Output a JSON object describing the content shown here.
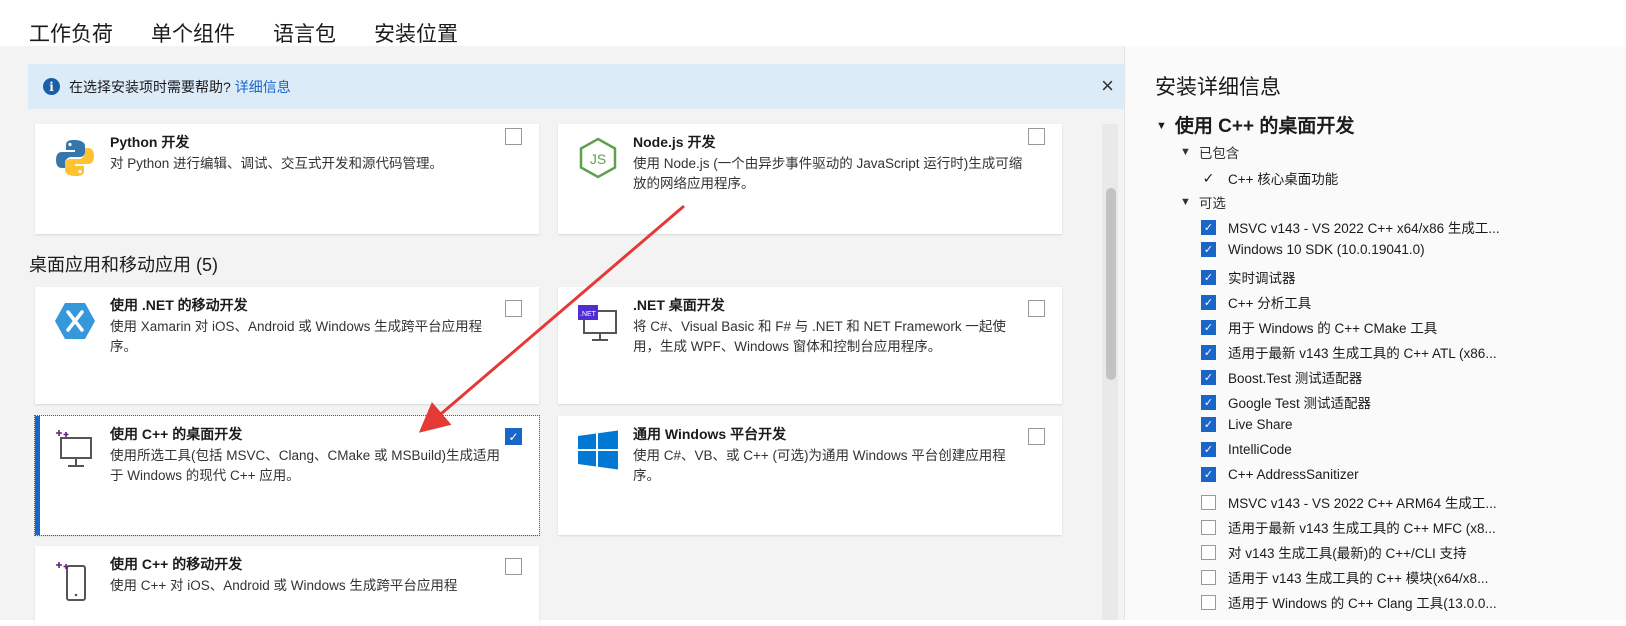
{
  "tabs": [
    "工作负荷",
    "单个组件",
    "语言包",
    "安装位置"
  ],
  "info": {
    "text": "在选择安装项时需要帮助?",
    "link": "详细信息",
    "close": "×"
  },
  "section_title": "桌面应用和移动应用 (5)",
  "cards": [
    {
      "title": "Python 开发",
      "desc": "对 Python 进行编辑、调试、交互式开发和源代码管理。",
      "checked": false
    },
    {
      "title": "Node.js 开发",
      "desc": "使用 Node.js (一个由异步事件驱动的 JavaScript 运行时)生成可缩放的网络应用程序。",
      "checked": false
    },
    {
      "title": "使用 .NET 的移动开发",
      "desc": "使用 Xamarin 对 iOS、Android 或 Windows 生成跨平台应用程序。",
      "checked": false
    },
    {
      "title": ".NET 桌面开发",
      "desc": "将 C#、Visual Basic 和 F# 与 .NET 和 NET Framework 一起使用，生成 WPF、Windows 窗体和控制台应用程序。",
      "checked": false
    },
    {
      "title": "使用 C++ 的桌面开发",
      "desc": "使用所选工具(包括 MSVC、Clang、CMake 或 MSBuild)生成适用于 Windows 的现代 C++ 应用。",
      "checked": true
    },
    {
      "title": "通用 Windows 平台开发",
      "desc": "使用 C#、VB、或 C++ (可选)为通用 Windows 平台创建应用程序。",
      "checked": false
    },
    {
      "title": "使用 C++ 的移动开发",
      "desc": "使用 C++ 对 iOS、Android 或 Windows 生成跨平台应用程",
      "checked": false
    }
  ],
  "node_icon_text": "JS",
  "net_badge": ".NET",
  "detail": {
    "title": "安装详细信息",
    "workload": "使用 C++ 的桌面开发",
    "included_label": "已包含",
    "included": [
      "C++ 核心桌面功能"
    ],
    "optional_label": "可选",
    "optional": [
      {
        "label": "MSVC v143 - VS 2022 C++ x64/x86 生成工...",
        "checked": true
      },
      {
        "label": "Windows 10 SDK (10.0.19041.0)",
        "checked": true
      },
      {
        "label": "实时调试器",
        "checked": true
      },
      {
        "label": "C++ 分析工具",
        "checked": true
      },
      {
        "label": "用于 Windows 的 C++ CMake 工具",
        "checked": true
      },
      {
        "label": "适用于最新 v143 生成工具的 C++ ATL (x86...",
        "checked": true
      },
      {
        "label": "Boost.Test 测试适配器",
        "checked": true
      },
      {
        "label": "Google Test 测试适配器",
        "checked": true
      },
      {
        "label": "Live Share",
        "checked": true
      },
      {
        "label": "IntelliCode",
        "checked": true
      },
      {
        "label": "C++ AddressSanitizer",
        "checked": true
      },
      {
        "label": "MSVC v143 - VS 2022 C++ ARM64 生成工...",
        "checked": false
      },
      {
        "label": "适用于最新 v143 生成工具的 C++ MFC (x8...",
        "checked": false
      },
      {
        "label": "对 v143 生成工具(最新)的 C++/CLI 支持",
        "checked": false
      },
      {
        "label": "适用于 v143 生成工具的 C++ 模块(x64/x8...",
        "checked": false
      },
      {
        "label": "适用于 Windows 的 C++ Clang 工具(13.0.0...",
        "checked": false
      }
    ]
  },
  "colors": {
    "accent": "#1a66c8",
    "info_bg": "#dcebf8",
    "arrow": "#e53935"
  }
}
